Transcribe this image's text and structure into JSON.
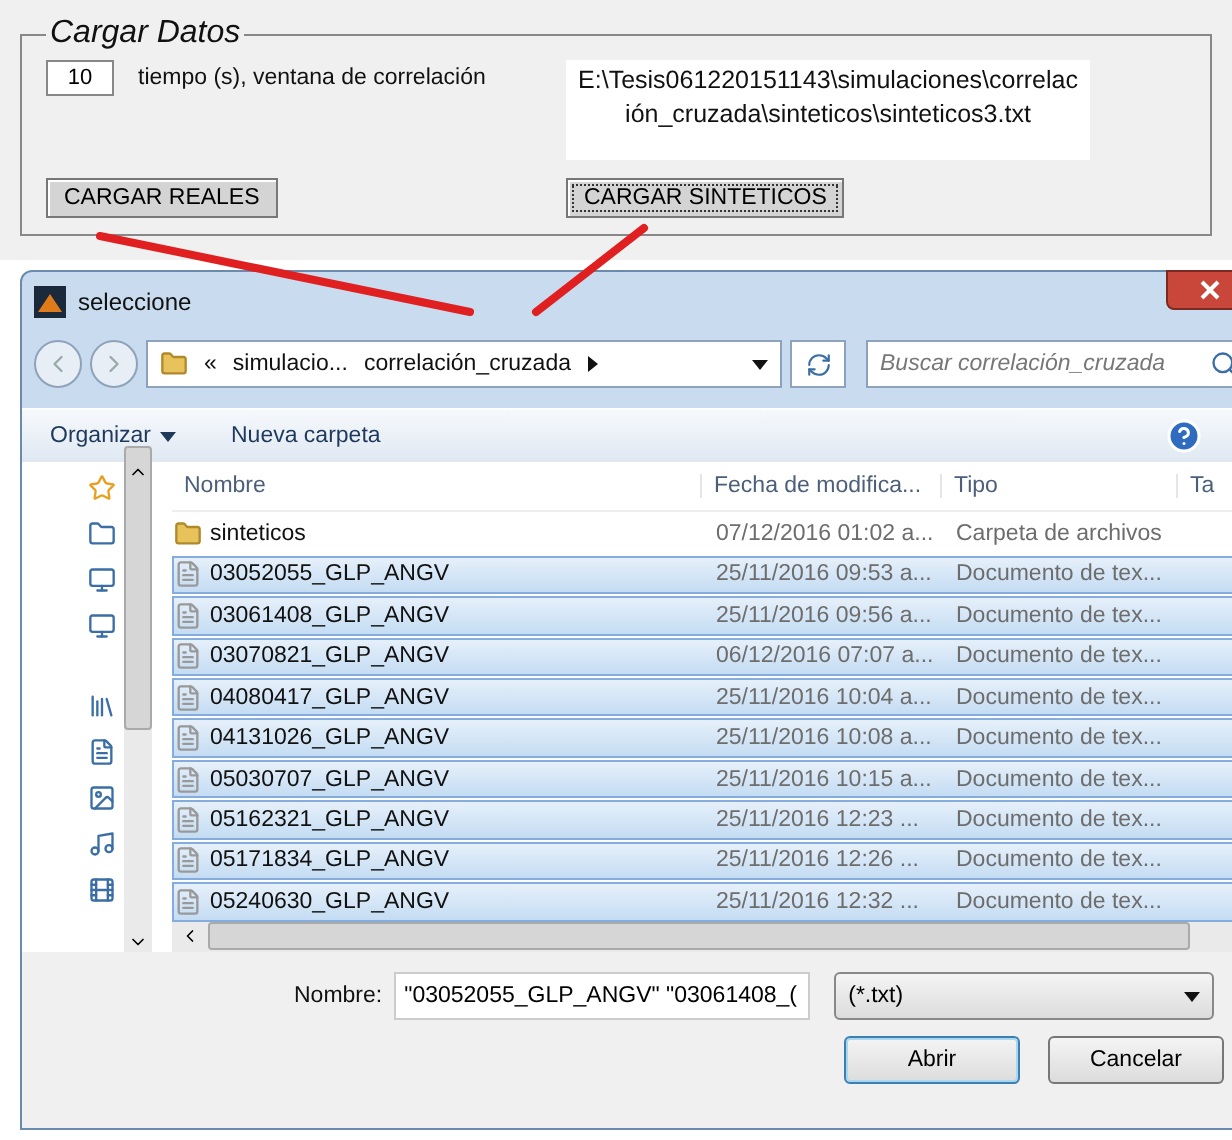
{
  "panel": {
    "title": "Cargar Datos",
    "window_field": {
      "value": "10"
    },
    "window_label": "tiempo (s), ventana de correlación",
    "path_text": "E:\\Tesis061220151143\\simulaciones\\correlación_cruzada\\sinteticos\\sinteticos3.txt",
    "buttons": [
      {
        "label": "CARGAR REALES",
        "focused": false
      },
      {
        "label": "CARGAR SINTETICOS",
        "focused": true
      }
    ]
  },
  "dialog": {
    "title": "seleccione",
    "breadcrumb": [
      "«",
      "simulacio...",
      "correlación_cruzada"
    ],
    "search": {
      "placeholder": "Buscar correlación_cruzada"
    },
    "toolbar": [
      "Organizar",
      "Nueva carpeta"
    ],
    "columns": [
      "Nombre",
      "Fecha de modifica...",
      "Tipo",
      "Ta"
    ],
    "rows": [
      {
        "kind": "folder",
        "name": "sinteticos",
        "date": "07/12/2016 01:02 a...",
        "type": "Carpeta de archivos",
        "selected": false
      },
      {
        "kind": "file",
        "name": "03052055_GLP_ANGV",
        "date": "25/11/2016 09:53 a...",
        "type": "Documento de tex...",
        "selected": true
      },
      {
        "kind": "file",
        "name": "03061408_GLP_ANGV",
        "date": "25/11/2016 09:56 a...",
        "type": "Documento de tex...",
        "selected": true
      },
      {
        "kind": "file",
        "name": "03070821_GLP_ANGV",
        "date": "06/12/2016 07:07 a...",
        "type": "Documento de tex...",
        "selected": true
      },
      {
        "kind": "file",
        "name": "04080417_GLP_ANGV",
        "date": "25/11/2016 10:04 a...",
        "type": "Documento de tex...",
        "selected": true
      },
      {
        "kind": "file",
        "name": "04131026_GLP_ANGV",
        "date": "25/11/2016 10:08 a...",
        "type": "Documento de tex...",
        "selected": true
      },
      {
        "kind": "file",
        "name": "05030707_GLP_ANGV",
        "date": "25/11/2016 10:15 a...",
        "type": "Documento de tex...",
        "selected": true
      },
      {
        "kind": "file",
        "name": "05162321_GLP_ANGV",
        "date": "25/11/2016 12:23 ...",
        "type": "Documento de tex...",
        "selected": true
      },
      {
        "kind": "file",
        "name": "05171834_GLP_ANGV",
        "date": "25/11/2016 12:26 ...",
        "type": "Documento de tex...",
        "selected": true
      },
      {
        "kind": "file",
        "name": "05240630_GLP_ANGV",
        "date": "25/11/2016 12:32 ...",
        "type": "Documento de tex...",
        "selected": true
      }
    ],
    "filename_label": "Nombre:",
    "filename": {
      "value": "\"03052055_GLP_ANGV\" \"03061408_("
    },
    "filter": {
      "value": "(*.txt)"
    },
    "buttons": [
      {
        "label": "Abrir",
        "default": true
      },
      {
        "label": "Cancelar",
        "default": false
      }
    ]
  }
}
